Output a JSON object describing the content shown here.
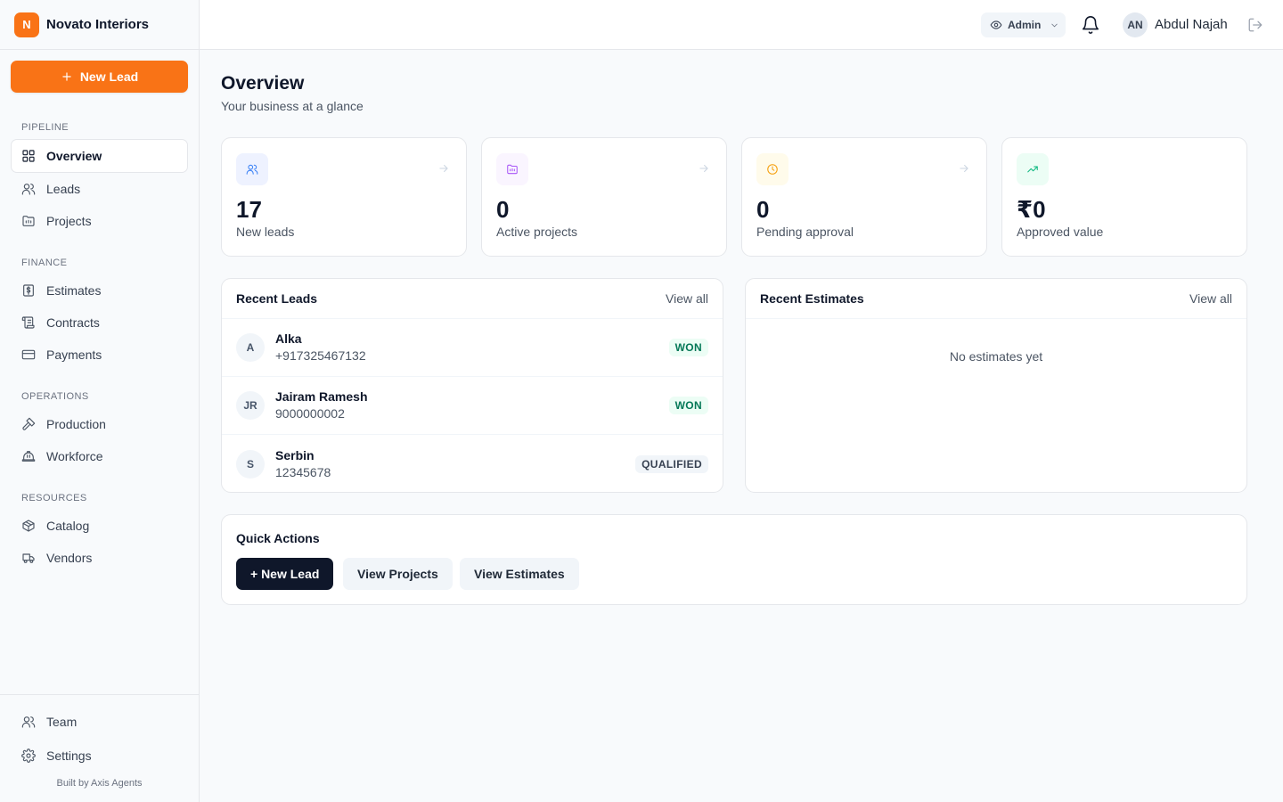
{
  "brand": {
    "logo_letter": "N",
    "name": "Novato Interiors"
  },
  "sidebar": {
    "new_lead_label": "New Lead",
    "sections": {
      "pipeline": "PIPELINE",
      "finance": "FINANCE",
      "operations": "OPERATIONS",
      "resources": "RESOURCES"
    },
    "items": {
      "overview": "Overview",
      "leads": "Leads",
      "projects": "Projects",
      "estimates": "Estimates",
      "contracts": "Contracts",
      "payments": "Payments",
      "production": "Production",
      "workforce": "Workforce",
      "catalog": "Catalog",
      "vendors": "Vendors",
      "team": "Team",
      "settings": "Settings"
    },
    "active_item": "Overview",
    "footer": "Built by Axis Agents"
  },
  "header": {
    "role": "Admin",
    "user_initials": "AN",
    "user_name": "Abdul Najah"
  },
  "main": {
    "title": "Overview",
    "subtitle": "Your business at a glance",
    "stats": [
      {
        "value": "17",
        "label": "New leads",
        "icon": "users-icon",
        "color": "#3b82f6",
        "bg": "#eef2ff"
      },
      {
        "value": "0",
        "label": "Active projects",
        "icon": "folder-icon",
        "color": "#a855f7",
        "bg": "#faf5ff"
      },
      {
        "value": "0",
        "label": "Pending approval",
        "icon": "clock-icon",
        "color": "#f59e0b",
        "bg": "#fffbeb"
      },
      {
        "value": "₹0",
        "label": "Approved value",
        "icon": "trending-up-icon",
        "color": "#10b981",
        "bg": "#ecfdf5"
      }
    ],
    "recent_leads": {
      "title": "Recent Leads",
      "view_all": "View all",
      "rows": [
        {
          "initials": "A",
          "name": "Alka",
          "phone": "+917325467132",
          "status": "WON"
        },
        {
          "initials": "JR",
          "name": "Jairam Ramesh",
          "phone": "9000000002",
          "status": "WON"
        },
        {
          "initials": "S",
          "name": "Serbin",
          "phone": "12345678",
          "status": "QUALIFIED"
        }
      ]
    },
    "recent_estimates": {
      "title": "Recent Estimates",
      "view_all": "View all",
      "empty": "No estimates yet"
    },
    "quick_actions": {
      "title": "Quick Actions",
      "new_lead": "+ New Lead",
      "view_projects": "View Projects",
      "view_estimates": "View Estimates"
    }
  },
  "colors": {
    "accent": "#f97316",
    "primary_dark": "#0f172a",
    "won": "#047857"
  }
}
